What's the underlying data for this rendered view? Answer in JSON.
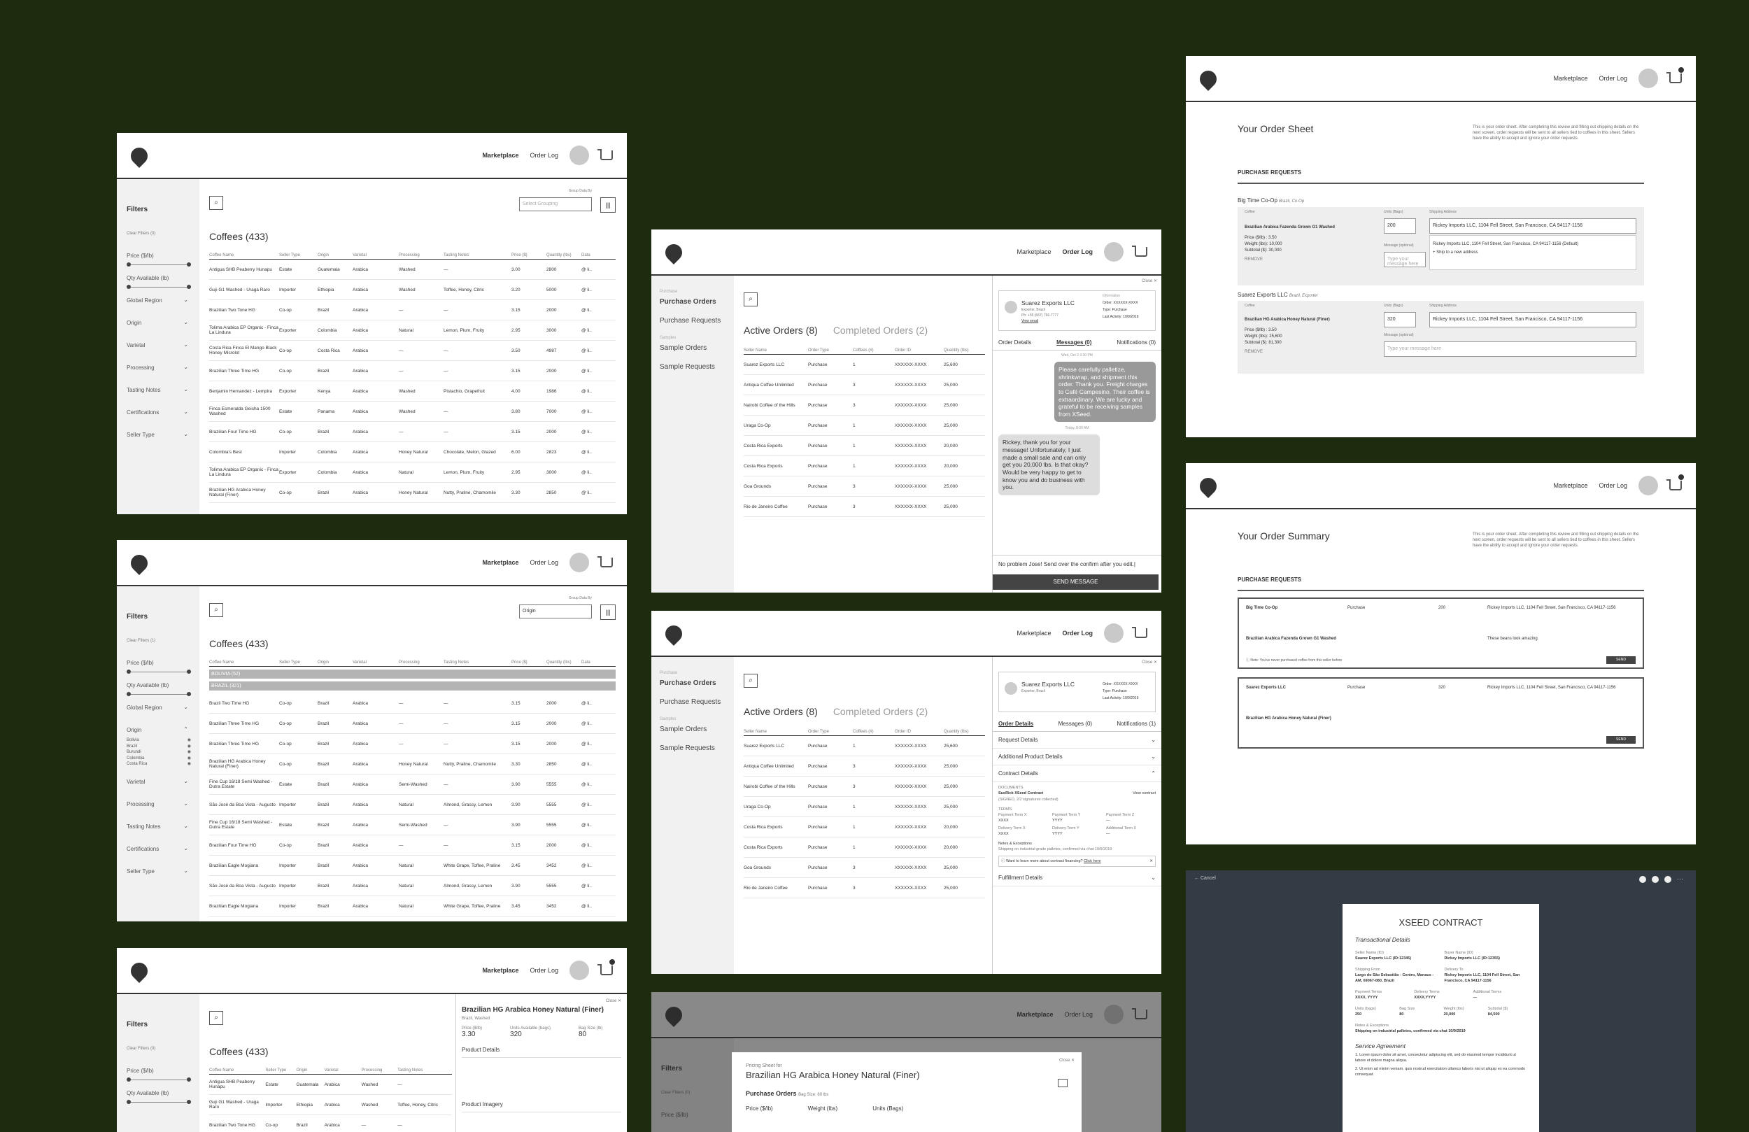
{
  "brand": {
    "accent": "#333333",
    "background": "#1d2b0e",
    "icon": "leaf-logo-icon"
  },
  "nav": {
    "marketplace": "Marketplace",
    "order_log": "Order Log"
  },
  "marketplace": {
    "filters_title": "Filters",
    "clear_filters_0": "Clear Filters (0)",
    "clear_filters_1": "Clear Filters (1)",
    "filters": [
      "Price ($/lb)",
      "Qty Available (lb)",
      "Global Region",
      "Origin",
      "Varietal",
      "Processing",
      "Tasting Notes",
      "Certifications",
      "Seller Type"
    ],
    "group_by_label": "Group Data By",
    "group_by_placeholder": "Select Grouping",
    "group_by_origin": "Origin",
    "title": "Coffees (433)",
    "columns": [
      "Coffee Name",
      "Seller Type",
      "Origin",
      "Varietal",
      "Processing",
      "Tasting Notes",
      "Price ($)",
      "Quantity (lbs)",
      "Data"
    ],
    "rows": [
      [
        "Antigua SHB Peaberry Hunapu",
        "Estate",
        "Guatemala",
        "Arabica",
        "Washed",
        "—",
        "3.00",
        "2800",
        "@ li.."
      ],
      [
        "Guji G1 Washed - Uraga Raro",
        "Importer",
        "Ethiopia",
        "Arabica",
        "Washed",
        "Toffee, Honey, Citric",
        "3.20",
        "5000",
        "@ li.."
      ],
      [
        "Brazilian Two Tone HG",
        "Co-op",
        "Brazil",
        "Arabica",
        "—",
        "—",
        "3.15",
        "2000",
        "@ li.."
      ],
      [
        "Tolima Arabica EP Organic - Finca La Lindura",
        "Exporter",
        "Colombia",
        "Arabica",
        "Natural",
        "Lemon, Plum, Fruity",
        "2.95",
        "3000",
        "@ li.."
      ],
      [
        "Costa Rica Finca El Mango Black Honey Microlot",
        "Co-op",
        "Costa Rica",
        "Arabica",
        "—",
        "—",
        "3.50",
        "4987",
        "@ li.."
      ],
      [
        "Brazilian Three Time HG",
        "Co-op",
        "Brazil",
        "Arabica",
        "—",
        "—",
        "3.15",
        "2000",
        "@ li.."
      ],
      [
        "Benjamin Hernandez - Lempira",
        "Exporter",
        "Kenya",
        "Arabica",
        "Washed",
        "Pistachio, Grapefruit",
        "4.00",
        "1986",
        "@ li.."
      ],
      [
        "Finca Esmeralda Geisha 1500 Washed",
        "Estate",
        "Panama",
        "Arabica",
        "Washed",
        "—",
        "3.80",
        "7000",
        "@ li.."
      ],
      [
        "Brazilian Four Time HG",
        "Co-op",
        "Brazil",
        "Arabica",
        "—",
        "—",
        "3.15",
        "2000",
        "@ li.."
      ],
      [
        "Colombia's Best",
        "Importer",
        "Colombia",
        "Arabica",
        "Honey Natural",
        "Chocolate, Melon, Glazed",
        "6.00",
        "2823",
        "@ li.."
      ],
      [
        "Tolima Arabica EP Organic - Finca La Lindura",
        "Exporter",
        "Colombia",
        "Arabica",
        "Natural",
        "Lemon, Plum, Fruity",
        "2.95",
        "3000",
        "@ li.."
      ],
      [
        "Brazilian HG Arabica Honey Natural (Finer)",
        "Co-op",
        "Brazil",
        "Arabica",
        "Honey Natural",
        "Nutty, Praline, Chamomile",
        "3.30",
        "2850",
        "@ li.."
      ]
    ],
    "group_bolivia": "BOLIVIA (52)",
    "group_brazil": "BRAZIL (321)",
    "grouped_rows": [
      [
        "Brazil Two Time HG",
        "Co-op",
        "Brazil",
        "Arabica",
        "—",
        "—",
        "3.15",
        "2000",
        "@ li.."
      ],
      [
        "Brazilian Three Time HG",
        "Co-op",
        "Brazil",
        "Arabica",
        "—",
        "—",
        "3.15",
        "2000",
        "@ li.."
      ],
      [
        "Brazilian Three Time HG",
        "Co-op",
        "Brazil",
        "Arabica",
        "—",
        "—",
        "3.15",
        "2000",
        "@ li.."
      ],
      [
        "Brazilian HG Arabica Honey Natural (Finer)",
        "Co-op",
        "Brazil",
        "Arabica",
        "Honey Natural",
        "Nutty, Praline, Chamomile",
        "3.30",
        "2850",
        "@ li.."
      ],
      [
        "Fine Cup 16/18 Semi Washed - Dutra Estate",
        "Estate",
        "Brazil",
        "Arabica",
        "Semi-Washed",
        "—",
        "3.90",
        "5555",
        "@ li.."
      ],
      [
        "São José da Boa Vista - Augusto",
        "Importer",
        "Brazil",
        "Arabica",
        "Natural",
        "Almond, Grassy, Lemon",
        "3.90",
        "5555",
        "@ li.."
      ],
      [
        "Fine Cup 16/18 Semi Washed - Dutra Estate",
        "Estate",
        "Brazil",
        "Arabica",
        "Semi-Washed",
        "—",
        "3.90",
        "5555",
        "@ li.."
      ],
      [
        "Brazilian Four Time HG",
        "Co-op",
        "Brazil",
        "Arabica",
        "—",
        "—",
        "3.15",
        "2000",
        "@ li.."
      ],
      [
        "Brazilian Eagle Mogiana",
        "Importer",
        "Brazil",
        "Arabica",
        "Natural",
        "White Grape, Toffee, Praline",
        "3.45",
        "3452",
        "@ li.."
      ],
      [
        "São José da Boa Vista - Augusto",
        "Importer",
        "Brazil",
        "Arabica",
        "Natural",
        "Almond, Grassy, Lemon",
        "3.90",
        "5555",
        "@ li.."
      ],
      [
        "Brazilian Eagle Mogiana",
        "Importer",
        "Brazil",
        "Arabica",
        "Natural",
        "White Grape, Toffee, Praline",
        "3.45",
        "3452",
        "@ li.."
      ]
    ],
    "origin_options": [
      "Bolivia",
      "Brazil",
      "Burundi",
      "Colombia",
      "Costa Rica"
    ],
    "detail_title": "Brazilian HG Arabica Honey Natural (Finer)",
    "detail_seller": "Brazil, Washed",
    "detail_price_label": "Price ($/lb)",
    "detail_price": "3.30",
    "detail_units_label": "Units Available (bags)",
    "detail_units": "320",
    "detail_bag_label": "Bag Size (lb)",
    "detail_bag": "80",
    "detail_product": "Product Details",
    "detail_imagery": "Product Imagery",
    "close": "Close"
  },
  "orders": {
    "sidebar_purchase": "Purchase",
    "purchase_orders": "Purchase Orders",
    "purchase_requests": "Purchase Requests",
    "sidebar_samples": "Samples",
    "sample_orders": "Sample Orders",
    "sample_requests": "Sample Requests",
    "tab_active": "Active Orders (8)",
    "tab_completed": "Completed Orders (2)",
    "columns": [
      "Seller Name",
      "Order Type",
      "Coffees (#)",
      "Order ID",
      "Quantity (lbs)"
    ],
    "rows": [
      [
        "Suarez Exports LLC",
        "Purchase",
        "1",
        "XXXXXX-XXXX",
        "25,600"
      ],
      [
        "Antiqua Coffee Unlimited",
        "Purchase",
        "3",
        "XXXXXX-XXXX",
        "25,000"
      ],
      [
        "Nairobi Coffee of the Hills",
        "Purchase",
        "3",
        "XXXXXX-XXXX",
        "25,000"
      ],
      [
        "Uraga Co-Op",
        "Purchase",
        "1",
        "XXXXXX-XXXX",
        "25,000"
      ],
      [
        "Costa Rica Exports",
        "Purchase",
        "1",
        "XXXXXX-XXXX",
        "20,000"
      ],
      [
        "Costa Rica Exports",
        "Purchase",
        "1",
        "XXXXXX-XXXX",
        "20,000"
      ],
      [
        "Goa Grounds",
        "Purchase",
        "3",
        "XXXXXX-XXXX",
        "25,000"
      ],
      [
        "Rio de Janeiro Coffee",
        "Purchase",
        "3",
        "XXXXXX-XXXX",
        "25,000"
      ]
    ],
    "seller_name": "Suarez Exports LLC",
    "seller_sub": "Exporter, Brazil",
    "seller_phone": "Ph: +55 (667) 766-7777",
    "seller_email": "View email",
    "info_title": "Information",
    "info_order": "Order: XXXXXX-XXXX",
    "info_type": "Type: Purchase",
    "info_activity": "Last Activity: 10/9/2019",
    "tab_order_details": "Order Details",
    "tab_messages": "Messages (0)",
    "tab_notifications": "Notifications (0)",
    "tab_notifications_1": "Notifications (1)",
    "msg_date1": "Wed, Oct 2 3:30 PM",
    "msg1": "Please carefully palletize, shrinkwrap, and shipment this order. Thank you. Freight charges to Café Campesino. Their coffee is extraordinary. We are lucky and grateful to be receiving samples from XSeed.",
    "msg_date2": "Today, 8:00 AM",
    "msg2": "Rickey, thank you for your message! Unfortunately, I just made a small sale and can only get you 20,000 lbs. Is that okay? Would be very happy to get to know you and do business with you.",
    "reply": "No problem Jose! Send over the confirm after you edit.|",
    "send": "SEND MESSAGE",
    "acc_request": "Request Details",
    "acc_additional": "Additional Product Details",
    "acc_contract": "Contract Details",
    "docs": "DOCUMENTS",
    "doc_name": "SueRick XSeed Contract",
    "doc_status": "(SIGNED, 2/2 signatures collected)",
    "view_contract": "View contract",
    "terms": "TERMS",
    "term_labels": [
      "Payment Term X",
      "Payment Term Y",
      "Payment Term Z",
      "Delivery Term X",
      "Delivery Term Y",
      "Additional Term X"
    ],
    "term_values": [
      "XXXX",
      "YYYY",
      "—",
      "XXXX",
      "YYYY",
      "—"
    ],
    "notes": "Notes & Exceptions",
    "notes_text": "Shipping on industrial grade palletes, confirmed via chat 10/9/2019",
    "finance": "Want to learn more about contract financing?",
    "click_here": "Click here",
    "fulfillment": "Fulfillment Details",
    "close": "Close"
  },
  "order_sheet": {
    "title": "Your Order Sheet",
    "summary_title": "Your Order Summary",
    "desc": "This is your order sheet. After completing this review and filling out shipping details on the next screen, order requests will be sent to all sellers tied to coffees in this sheet. Sellers have the ability to accept and ignore your order requests.",
    "section": "PURCHASE REQUESTS",
    "seller1": "Big Time Co-Op",
    "seller1_sub": "Brazil, Co-Op",
    "seller2": "Suarez Exports LLC",
    "seller2_sub": "Brazil, Exporter",
    "coffee_label": "Coffee",
    "coffee1": "Brazilian Arabica Fazenda Grown G1 Washed",
    "coffee2": "Brazilian HG Arabica Honey Natural (Finer)",
    "price1": "Price ($/lb) : 3.50",
    "price2": "Price ($/lb) : 3.50",
    "weight1": "Weight (lbs): 10,000",
    "weight2": "Weight (lbs): 25,600",
    "subtotal1": "Subtotal ($): 30,000",
    "subtotal2": "Subtotal ($): 81,300",
    "remove": "REMOVE",
    "units_label": "Units (Bags)",
    "units1": "200",
    "units2": "320",
    "ship_label": "Shipping Address",
    "address": "Rickey Imports LLC, 1104 Fell Street, San Francisco, CA 94117-1156",
    "address_default": "Rickey Imports LLC, 1104 Fell Street, San Francisco, CA 94117-1156 (Default)",
    "ship_new": "+ Ship to a new address",
    "message_label": "Message (optional)",
    "message_ph": "Type your message here",
    "message1": "These beans look amazing",
    "note": "Note: You've never purchased coffee from this seller before",
    "order_type": "Order Type",
    "purchase": "Purchase",
    "send": "SEND"
  },
  "contract": {
    "cancel": "Cancel",
    "title": "XSEED CONTRACT",
    "section": "Transactional Details",
    "seller_label": "Seller Name (ID)",
    "seller": "Suarez Exports LLC (ID:12345)",
    "buyer_label": "Buyer Name (ID)",
    "buyer": "Rickey Imports LLC (ID:12355)",
    "ship_from_label": "Shipping From",
    "ship_from": "Largo do São Sebastião - Centro, Manaus - AM, 69067-080, Brazil",
    "deliver_label": "Delivery To",
    "deliver": "Rickey Imports LLC, 1104 Fell Street, San Francisco, CA 94117-1156",
    "terms_labels": [
      "Payment Terms",
      "Delivery Terms",
      "Additional Terms"
    ],
    "terms_values": [
      "XXXX, YYYY",
      "XXXX,YYYY",
      "—"
    ],
    "q_labels": [
      "Units (bags)",
      "Bag Size",
      "Weight (lbs)",
      "Subtotal ($)"
    ],
    "q_values": [
      "250",
      "80",
      "20,000",
      "84,500"
    ],
    "notes_label": "Notes & Exceptions",
    "notes": "Shipping on industrial palletes, confirmed via chat 10/9/2019",
    "service": "Service Agreement",
    "clause1": "1. Lorem ipsum dolor sit amet, consectetur adipiscing elit, sed do eiusmod tempor incididunt ut labore et dolore magna aliqua.",
    "clause2": "2. Ut enim ad minim veniam, quis nostrud exercitation ullamco laboris nisi ut aliquip ex ea commodo consequat."
  },
  "pricing": {
    "sheet_for": "Pricing Sheet for",
    "title": "Brazilian HG Arabica Honey Natural (Finer)",
    "purchase_orders": "Purchase Orders",
    "bag": "Bag Size: 80 lbs",
    "cols": [
      "Price ($/lb)",
      "Weight (lbs)",
      "Units (Bags)"
    ],
    "close": "Close"
  }
}
